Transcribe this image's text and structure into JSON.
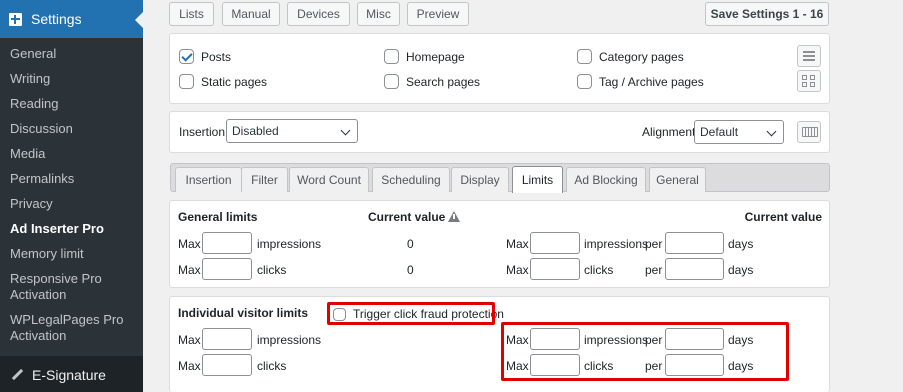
{
  "sidebar": {
    "header": "Settings",
    "items": [
      "General",
      "Writing",
      "Reading",
      "Discussion",
      "Media",
      "Permalinks",
      "Privacy",
      "Ad Inserter Pro",
      "Memory limit",
      "Responsive Pro Activation",
      "WPLegalPages Pro Activation"
    ],
    "current_index": 7,
    "footer": "E-Signature"
  },
  "toolbar": {
    "lists": "Lists",
    "manual": "Manual",
    "devices": "Devices",
    "misc": "Misc",
    "preview": "Preview",
    "save": "Save Settings 1 - 16"
  },
  "page_types": {
    "posts": "Posts",
    "homepage": "Homepage",
    "category": "Category pages",
    "static": "Static pages",
    "search": "Search pages",
    "tag_archive": "Tag / Archive pages"
  },
  "insertion": {
    "label": "Insertion",
    "value": "Disabled",
    "alignment_label": "Alignment",
    "alignment_value": "Default"
  },
  "tabs": [
    "Insertion",
    "Filter",
    "Word Count",
    "Scheduling",
    "Display",
    "Limits",
    "Ad Blocking",
    "General"
  ],
  "active_tab": "Limits",
  "general_limits": {
    "title": "General limits",
    "current_value_label": "Current value",
    "current_value_right": "Current value",
    "max": "Max",
    "impressions": "impressions",
    "clicks": "clicks",
    "per": "per",
    "days": "days",
    "impressions_value": "0",
    "clicks_value": "0"
  },
  "visitor_limits": {
    "title": "Individual visitor limits",
    "trigger_label": "Trigger click fraud protection",
    "max": "Max",
    "impressions": "impressions",
    "clicks": "clicks",
    "per": "per",
    "days": "days"
  }
}
